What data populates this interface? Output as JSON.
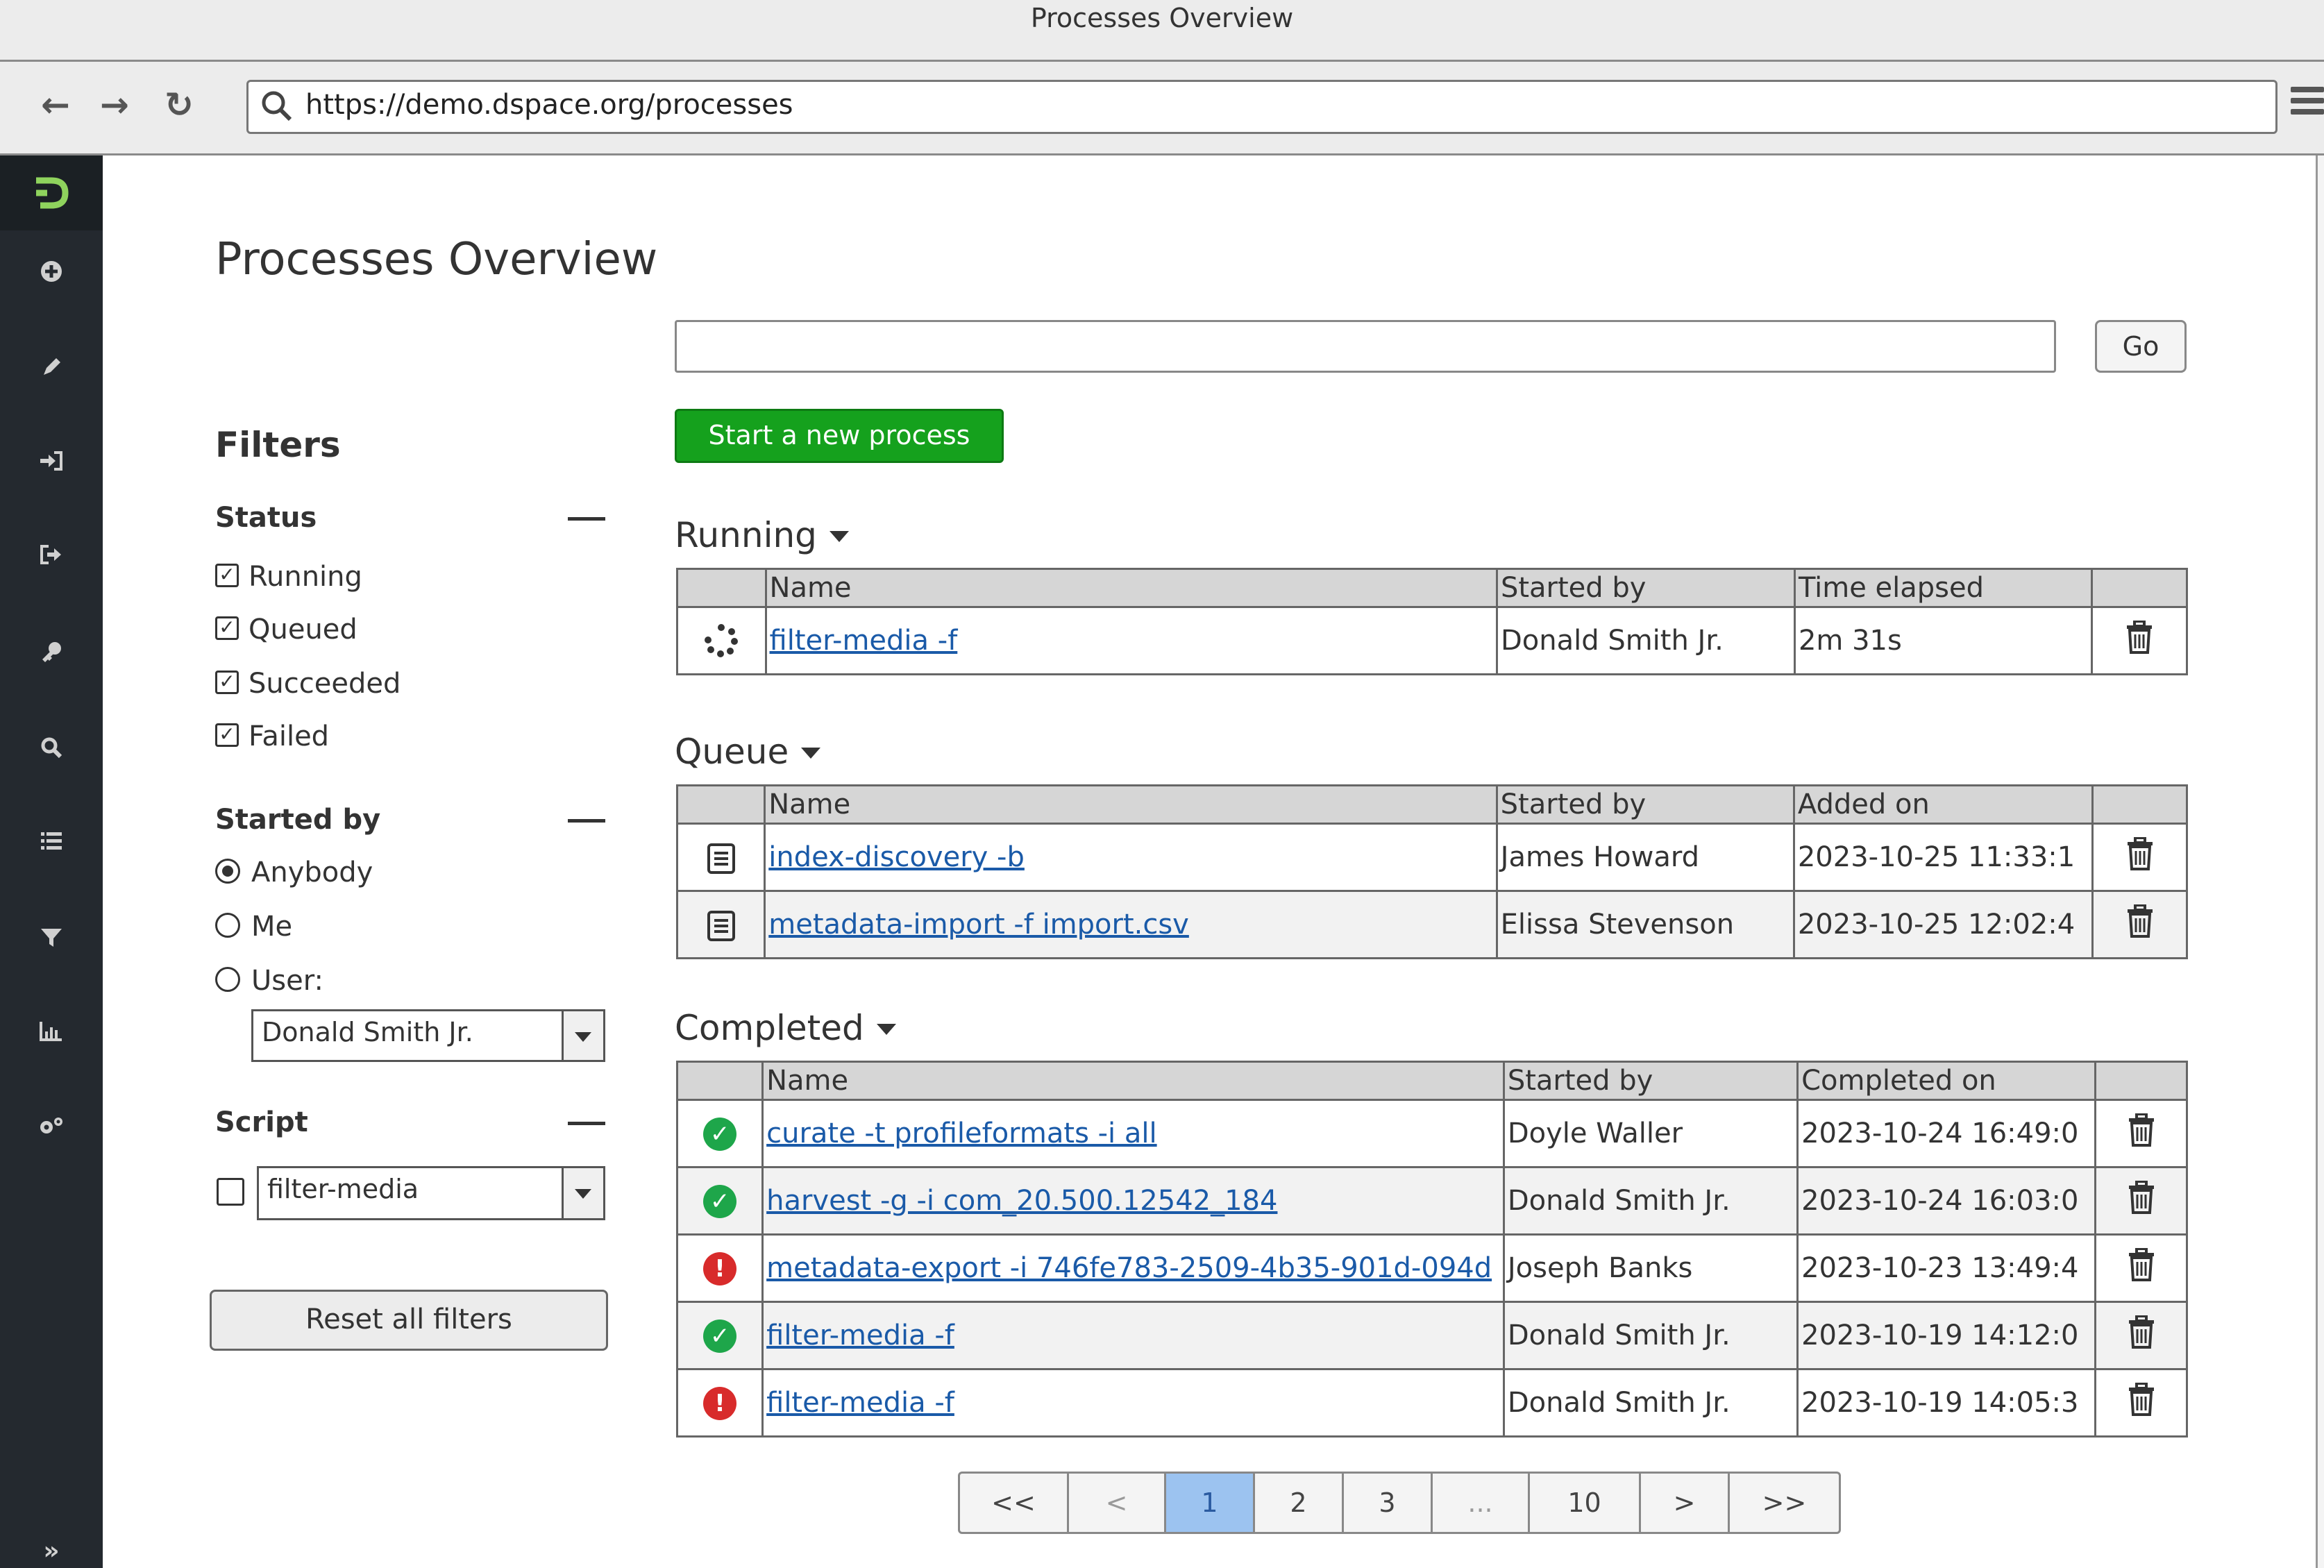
{
  "browser": {
    "window_title": "Processes Overview",
    "url": "https://demo.dspace.org/processes",
    "icons": [
      "back-arrow-icon",
      "forward-arrow-icon",
      "reload-icon",
      "search-icon",
      "hamburger-menu-icon"
    ]
  },
  "sidebar": {
    "logo": "Đ",
    "icons": [
      "add-icon",
      "pencil-icon",
      "login-icon",
      "logout-icon",
      "key-icon",
      "search-icon",
      "list-icon",
      "filter-icon",
      "chart-icon",
      "gears-icon"
    ],
    "expand": "»"
  },
  "page": {
    "title": "Processes Overview"
  },
  "search": {
    "placeholder": "",
    "go_label": "Go"
  },
  "actions": {
    "new_process": "Start a new process"
  },
  "filters": {
    "heading": "Filters",
    "status": {
      "title": "Status",
      "options": [
        "Running",
        "Queued",
        "Succeeded",
        "Failed"
      ],
      "checked": [
        true,
        true,
        true,
        true
      ]
    },
    "started_by": {
      "title": "Started by",
      "options": [
        "Anybody",
        "Me",
        "User:"
      ],
      "selected": "Anybody",
      "user_value": "Donald Smith Jr."
    },
    "script": {
      "title": "Script",
      "value": "filter-media",
      "checked": false
    },
    "reset_label": "Reset all filters"
  },
  "running": {
    "title": "Running",
    "columns": [
      "Name",
      "Started by",
      "Time elapsed"
    ],
    "rows": [
      {
        "name": "filter-media -f",
        "by": "Donald Smith Jr.",
        "time": "2m 31s",
        "icon": "spinner-icon"
      }
    ]
  },
  "queue": {
    "title": "Queue",
    "columns": [
      "Name",
      "Started by",
      "Added on"
    ],
    "rows": [
      {
        "name": "index-discovery -b",
        "by": "James Howard",
        "time": "2023-10-25 11:33:1",
        "icon": "queued-icon"
      },
      {
        "name": "metadata-import -f import.csv",
        "by": "Elissa Stevenson",
        "time": "2023-10-25 12:02:4",
        "icon": "queued-icon"
      }
    ]
  },
  "completed": {
    "title": "Completed",
    "columns": [
      "Name",
      "Started by",
      "Completed on"
    ],
    "rows": [
      {
        "name": "curate -t profileformats -i all",
        "by": "Doyle Waller",
        "time": "2023-10-24 16:49:0",
        "status": "success"
      },
      {
        "name": "harvest -g -i com_20.500.12542_184",
        "by": "Donald Smith Jr.",
        "time": "2023-10-24 16:03:0",
        "status": "success"
      },
      {
        "name": "metadata-export -i 746fe783-2509-4b35-901d-094d",
        "by": "Joseph Banks",
        "time": "2023-10-23 13:49:4",
        "status": "failed"
      },
      {
        "name": "filter-media -f",
        "by": "Donald Smith Jr.",
        "time": "2023-10-19 14:12:0",
        "status": "success"
      },
      {
        "name": "filter-media -f",
        "by": "Donald Smith Jr.",
        "time": "2023-10-19 14:05:3",
        "status": "failed"
      }
    ]
  },
  "pagination": {
    "items": [
      "<<",
      "<",
      "1",
      "2",
      "3",
      "...",
      "10",
      ">",
      ">>"
    ],
    "active": "1"
  },
  "colors": {
    "primary_button": "#15a11d",
    "success": "#1ea64a",
    "failure": "#d82b2b",
    "link": "#1a5aa8",
    "active_page": "#9cc3f0"
  }
}
